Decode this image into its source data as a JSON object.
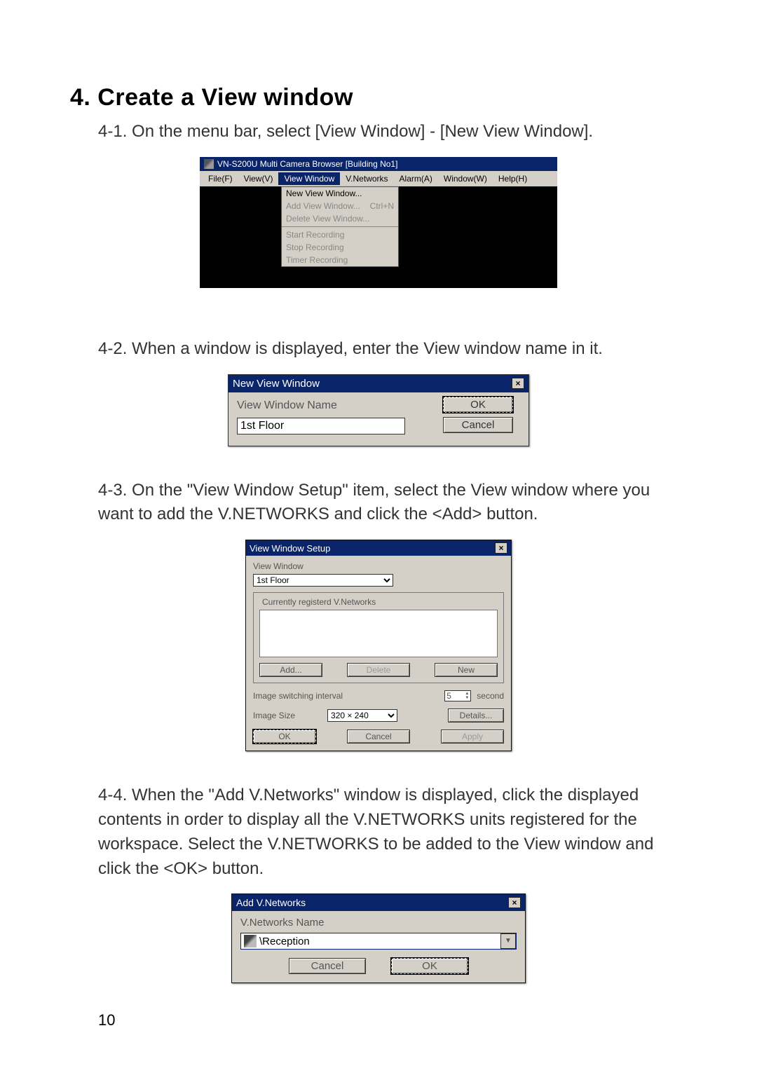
{
  "section": {
    "title": "4. Create a View window"
  },
  "steps": {
    "s1": "4-1. On the menu bar, select [View Window] - [New View Window].",
    "s2": "4-2. When a window is displayed, enter the View window name in it.",
    "s3": "4-3. On the \"View Window Setup\" item, select the View window where you want to add the V.NETWORKS and click the <Add> button.",
    "s4": "4-4. When the \"Add V.Networks\" window is displayed, click the displayed contents in order to display all the V.NETWORKS units registered for the workspace. Select the V.NETWORKS to be added to the View window and click the <OK> button."
  },
  "fig1": {
    "title": "VN-S200U Multi Camera Browser [Building No1]",
    "menu": {
      "file": "File(F)",
      "view": "View(V)",
      "viewWindow": "View Window",
      "vnetworks": "V.Networks",
      "alarm": "Alarm(A)",
      "window": "Window(W)",
      "help": "Help(H)"
    },
    "drop": {
      "newViewWindow": "New View Window...",
      "addViewWindow": "Add View Window...",
      "addViewWindowShortcut": "Ctrl+N",
      "deleteViewWindow": "Delete View Window...",
      "startRecording": "Start Recording",
      "stopRecording": "Stop Recording",
      "timerRecording": "Timer Recording"
    }
  },
  "fig2": {
    "title": "New View Window",
    "label": "View Window Name",
    "value": "1st Floor",
    "ok": "OK",
    "cancel": "Cancel"
  },
  "fig3": {
    "title": "View Window Setup",
    "viewWindowLabel": "View Window",
    "viewWindowValue": "1st Floor",
    "groupTitle": "Currently registerd V.Networks",
    "add": "Add...",
    "delete": "Delete",
    "new": "New",
    "switchLabel": "Image switching interval",
    "switchValue": "5",
    "switchUnit": "second",
    "sizeLabel": "Image Size",
    "sizeValue": "320 × 240",
    "details": "Details...",
    "ok": "OK",
    "cancel": "Cancel",
    "apply": "Apply"
  },
  "fig4": {
    "title": "Add V.Networks",
    "label": "V.Networks Name",
    "value": "\\Reception",
    "cancel": "Cancel",
    "ok": "OK"
  },
  "pageNumber": "10"
}
